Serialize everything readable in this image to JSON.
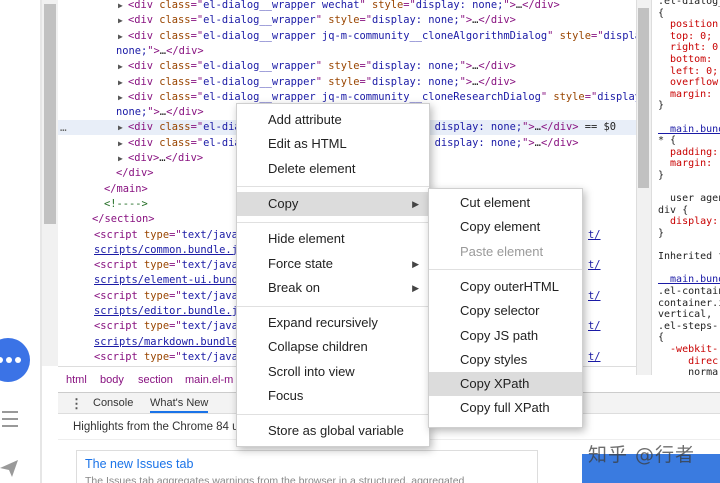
{
  "elements_panel": {
    "lines": [
      {
        "indent": 0,
        "arrow": "▶",
        "parts": [
          [
            "tag",
            "<div "
          ],
          [
            "attr",
            "class"
          ],
          [
            "tag",
            "=\""
          ],
          [
            "val",
            "el-dialog__wrapper wechat"
          ],
          [
            "tag",
            "\" "
          ],
          [
            "attr",
            "style"
          ],
          [
            "tag",
            "=\""
          ],
          [
            "val",
            "display: none;"
          ],
          [
            "tag",
            "\">"
          ],
          [
            "txt",
            "…"
          ],
          [
            "tag",
            "</div>"
          ]
        ]
      },
      {
        "indent": 0,
        "arrow": "▶",
        "parts": [
          [
            "tag",
            "<div "
          ],
          [
            "attr",
            "class"
          ],
          [
            "tag",
            "=\""
          ],
          [
            "val",
            "el-dialog__wrapper"
          ],
          [
            "tag",
            "\" "
          ],
          [
            "attr",
            "style"
          ],
          [
            "tag",
            "=\""
          ],
          [
            "val",
            "display: none;"
          ],
          [
            "tag",
            "\">"
          ],
          [
            "txt",
            "…"
          ],
          [
            "tag",
            "</div>"
          ]
        ]
      },
      {
        "indent": 0,
        "arrow": "▶",
        "parts": [
          [
            "tag",
            "<div "
          ],
          [
            "attr",
            "class"
          ],
          [
            "tag",
            "=\""
          ],
          [
            "val",
            "el-dialog__wrapper jq-m-community__cloneAlgorithmDialog"
          ],
          [
            "tag",
            "\" "
          ],
          [
            "attr",
            "style"
          ],
          [
            "tag",
            "=\""
          ],
          [
            "val",
            "display:"
          ]
        ]
      },
      {
        "indent": -1,
        "arrow": "",
        "parts": [
          [
            "val",
            "none;"
          ],
          [
            "tag",
            "\">"
          ],
          [
            "txt",
            "…"
          ],
          [
            "tag",
            "</div>"
          ]
        ]
      },
      {
        "indent": 0,
        "arrow": "▶",
        "parts": [
          [
            "tag",
            "<div "
          ],
          [
            "attr",
            "class"
          ],
          [
            "tag",
            "=\""
          ],
          [
            "val",
            "el-dialog__wrapper"
          ],
          [
            "tag",
            "\" "
          ],
          [
            "attr",
            "style"
          ],
          [
            "tag",
            "=\""
          ],
          [
            "val",
            "display: none;"
          ],
          [
            "tag",
            "\">"
          ],
          [
            "txt",
            "…"
          ],
          [
            "tag",
            "</div>"
          ]
        ]
      },
      {
        "indent": 0,
        "arrow": "▶",
        "parts": [
          [
            "tag",
            "<div "
          ],
          [
            "attr",
            "class"
          ],
          [
            "tag",
            "=\""
          ],
          [
            "val",
            "el-dialog__wrapper"
          ],
          [
            "tag",
            "\" "
          ],
          [
            "attr",
            "style"
          ],
          [
            "tag",
            "=\""
          ],
          [
            "val",
            "display: none;"
          ],
          [
            "tag",
            "\">"
          ],
          [
            "txt",
            "…"
          ],
          [
            "tag",
            "</div>"
          ]
        ]
      },
      {
        "indent": 0,
        "arrow": "▶",
        "parts": [
          [
            "tag",
            "<div "
          ],
          [
            "attr",
            "class"
          ],
          [
            "tag",
            "=\""
          ],
          [
            "val",
            "el-dialog__wrapper jq-m-community__cloneResearchDialog"
          ],
          [
            "tag",
            "\" "
          ],
          [
            "attr",
            "style"
          ],
          [
            "tag",
            "=\""
          ],
          [
            "val",
            "display:"
          ]
        ]
      },
      {
        "indent": -1,
        "arrow": "",
        "parts": [
          [
            "val",
            "none;"
          ],
          [
            "tag",
            "\">"
          ],
          [
            "txt",
            "…"
          ],
          [
            "tag",
            "</div>"
          ]
        ]
      },
      {
        "indent": 0,
        "arrow": "▶",
        "selected": true,
        "parts": [
          [
            "tag",
            "<div "
          ],
          [
            "attr",
            "class"
          ],
          [
            "tag",
            "=\""
          ],
          [
            "val",
            "el-dia"
          ],
          [
            "txt",
            "                               "
          ],
          [
            "val",
            "display: none;"
          ],
          [
            "tag",
            "\">"
          ],
          [
            "txt",
            "…"
          ],
          [
            "tag",
            "</div>"
          ],
          [
            "txt",
            " == $0"
          ]
        ]
      },
      {
        "indent": 0,
        "arrow": "▶",
        "parts": [
          [
            "tag",
            "<div "
          ],
          [
            "attr",
            "class"
          ],
          [
            "tag",
            "=\""
          ],
          [
            "val",
            "el-dia"
          ],
          [
            "txt",
            "                               "
          ],
          [
            "val",
            "display: none;"
          ],
          [
            "tag",
            "\">"
          ],
          [
            "txt",
            "…"
          ],
          [
            "tag",
            "</div>"
          ]
        ]
      },
      {
        "indent": 0,
        "arrow": "▶",
        "parts": [
          [
            "tag",
            "<div>"
          ],
          [
            "txt",
            "…"
          ],
          [
            "tag",
            "</div>"
          ]
        ]
      },
      {
        "indent": 1,
        "arrow": "",
        "parts": [
          [
            "tag",
            "</div>"
          ]
        ]
      },
      {
        "indent": 2,
        "arrow": "",
        "parts": [
          [
            "tag",
            "</main>"
          ]
        ]
      },
      {
        "indent": 2,
        "arrow": "",
        "parts": [
          [
            "cmt",
            "<!---->"
          ]
        ]
      },
      {
        "indent": 3,
        "arrow": "",
        "parts": [
          [
            "tag",
            "</section>"
          ]
        ]
      },
      {
        "indent": 4,
        "arrow": "",
        "parts": [
          [
            "tag",
            "<script "
          ],
          [
            "attr",
            "type"
          ],
          [
            "tag",
            "=\""
          ],
          [
            "val",
            "text/java"
          ]
        ],
        "tail": "t/"
      },
      {
        "indent": 4,
        "arrow": "",
        "parts": [
          [
            "link",
            "scripts/common.bundle.js"
          ]
        ]
      },
      {
        "indent": 4,
        "arrow": "",
        "parts": [
          [
            "tag",
            "<script "
          ],
          [
            "attr",
            "type"
          ],
          [
            "tag",
            "=\""
          ],
          [
            "val",
            "text/java"
          ]
        ],
        "tail": "t/"
      },
      {
        "indent": 4,
        "arrow": "",
        "parts": [
          [
            "link",
            "scripts/element-ui.bund"
          ]
        ]
      },
      {
        "indent": 4,
        "arrow": "",
        "parts": [
          [
            "tag",
            "<script "
          ],
          [
            "attr",
            "type"
          ],
          [
            "tag",
            "=\""
          ],
          [
            "val",
            "text/java"
          ]
        ],
        "tail": "t/"
      },
      {
        "indent": 4,
        "arrow": "",
        "parts": [
          [
            "link",
            "scripts/editor.bundle.j"
          ]
        ]
      },
      {
        "indent": 4,
        "arrow": "",
        "parts": [
          [
            "tag",
            "<script "
          ],
          [
            "attr",
            "type"
          ],
          [
            "tag",
            "=\""
          ],
          [
            "val",
            "text/java"
          ]
        ],
        "tail": "t/"
      },
      {
        "indent": 4,
        "arrow": "",
        "parts": [
          [
            "link",
            "scripts/markdown.bundle"
          ]
        ]
      },
      {
        "indent": 4,
        "arrow": "",
        "parts": [
          [
            "tag",
            "<script "
          ],
          [
            "attr",
            "type"
          ],
          [
            "tag",
            "=\""
          ],
          [
            "val",
            "text/java"
          ]
        ],
        "tail": "t/"
      },
      {
        "indent": 4,
        "arrow": "",
        "parts": [
          [
            "link",
            "scripts/chart.bundle.js"
          ]
        ]
      }
    ],
    "selected_marker": "…"
  },
  "styles_pane": {
    "lines": [
      {
        "t": ".el-dialog__",
        "c": "txt"
      },
      {
        "t": "{",
        "c": "txt"
      },
      {
        "t": "  position:",
        "c": "prop"
      },
      {
        "t": "  top: 0;",
        "c": "prop"
      },
      {
        "t": "  right: 0",
        "c": "prop"
      },
      {
        "t": "  bottom:",
        "c": "prop"
      },
      {
        "t": "  left: 0;",
        "c": "prop"
      },
      {
        "t": "  overflow",
        "c": "prop"
      },
      {
        "t": "  margin:",
        "c": "prop"
      },
      {
        "t": "}",
        "c": "txt"
      },
      {
        "t": "",
        "c": "txt"
      },
      {
        "t": "  main.bund",
        "c": "link"
      },
      {
        "t": "* {",
        "c": "txt"
      },
      {
        "t": "  padding:",
        "c": "prop"
      },
      {
        "t": "  margin:",
        "c": "prop"
      },
      {
        "t": "}",
        "c": "txt"
      },
      {
        "t": "",
        "c": "txt"
      },
      {
        "t": "  user agen",
        "c": "txt"
      },
      {
        "t": "div {",
        "c": "txt"
      },
      {
        "t": "  display:",
        "c": "prop"
      },
      {
        "t": "}",
        "c": "txt"
      },
      {
        "t": "",
        "c": "txt"
      },
      {
        "t": "Inherited fro",
        "c": "txt"
      },
      {
        "t": "",
        "c": "txt"
      },
      {
        "t": "  main.bund",
        "c": "link"
      },
      {
        "t": ".el-contain",
        "c": "txt"
      },
      {
        "t": "container.i",
        "c": "txt"
      },
      {
        "t": "vertical, .",
        "c": "txt"
      },
      {
        "t": ".el-steps--",
        "c": "txt"
      },
      {
        "t": "{",
        "c": "txt"
      },
      {
        "t": "  -webkit-",
        "c": "prop"
      },
      {
        "t": "     direc",
        "c": "prop"
      },
      {
        "t": "     norma",
        "c": "txt"
      }
    ]
  },
  "breadcrumb": {
    "items": [
      "html",
      "body",
      "section",
      "main.el-m"
    ]
  },
  "drawer": {
    "tabs": [
      "Console",
      "What's New"
    ],
    "highlights": "Highlights from the Chrome 84 up",
    "card_title": "The new Issues tab",
    "card_desc": "The Issues tab aggregates warnings from the browser in a structured, aggregated"
  },
  "context_menu": {
    "items": [
      {
        "label": "Add attribute"
      },
      {
        "label": "Edit as HTML"
      },
      {
        "label": "Delete element"
      },
      {
        "sep": true
      },
      {
        "label": "Copy",
        "sub": true,
        "highlighted": true
      },
      {
        "sep": true
      },
      {
        "label": "Hide element"
      },
      {
        "label": "Force state",
        "sub": true
      },
      {
        "label": "Break on",
        "sub": true
      },
      {
        "sep": true
      },
      {
        "label": "Expand recursively"
      },
      {
        "label": "Collapse children"
      },
      {
        "label": "Scroll into view"
      },
      {
        "label": "Focus"
      },
      {
        "sep": true
      },
      {
        "label": "Store as global variable"
      }
    ]
  },
  "copy_submenu": {
    "items": [
      {
        "label": "Cut element"
      },
      {
        "label": "Copy element"
      },
      {
        "label": "Paste element",
        "disabled": true
      },
      {
        "sep": true
      },
      {
        "label": "Copy outerHTML"
      },
      {
        "label": "Copy selector"
      },
      {
        "label": "Copy JS path"
      },
      {
        "label": "Copy styles"
      },
      {
        "label": "Copy XPath",
        "highlighted": true
      },
      {
        "label": "Copy full XPath"
      }
    ]
  },
  "watermark": "知乎 @行者",
  "colors": {
    "accent": "#1a73e8",
    "chat_button": "#3b73e6",
    "tag": "#881280",
    "attr": "#994500",
    "value": "#1a1aa6"
  }
}
